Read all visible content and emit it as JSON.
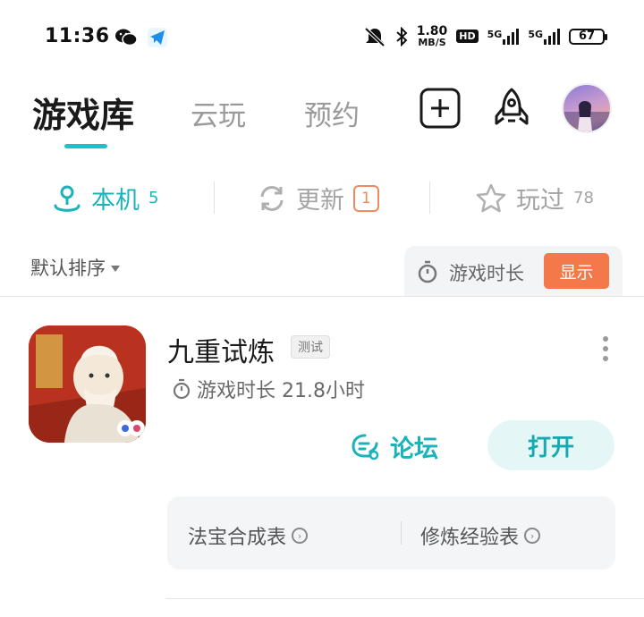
{
  "status_bar": {
    "time": "11:36",
    "speed_value": "1.80",
    "speed_unit": "MB/S",
    "hd_label": "HD",
    "net1": "5G",
    "net2": "5G",
    "battery": "67",
    "icons": [
      "wechat-icon",
      "telegram-icon",
      "mute-icon",
      "bluetooth-icon"
    ]
  },
  "top_tabs": [
    {
      "label": "游戏库",
      "active": true
    },
    {
      "label": "云玩",
      "active": false
    },
    {
      "label": "预约",
      "active": false
    }
  ],
  "top_actions": [
    "add-icon",
    "rocket-icon",
    "avatar"
  ],
  "sub_tabs": {
    "local": {
      "label": "本机",
      "count": "5"
    },
    "update": {
      "label": "更新",
      "badge": "1"
    },
    "played": {
      "label": "玩过",
      "count": "78"
    }
  },
  "sort": {
    "label": "默认排序"
  },
  "playtime_toggle": {
    "label": "游戏时长",
    "button": "显示"
  },
  "game": {
    "title": "九重试炼",
    "tag": "测试",
    "playtime": "游戏时长 21.8小时",
    "forum_label": "论坛",
    "open_label": "打开",
    "links": [
      "法宝合成表",
      "修炼经验表"
    ]
  },
  "colors": {
    "accent": "#1ec1c7",
    "orange": "#f3784a"
  }
}
